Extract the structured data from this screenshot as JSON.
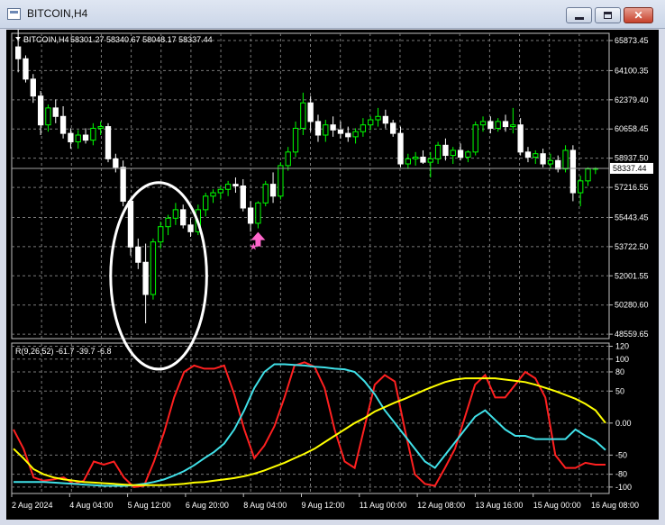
{
  "window": {
    "title": "BITCOIN,H4"
  },
  "chart_data": [
    {
      "type": "candlestick",
      "title": "BITCOIN,H4",
      "ohlc_label": "58301.27 58340.67 58048.17 58337.44",
      "y_ticks": [
        "65873.45",
        "64100.35",
        "62379.40",
        "60658.45",
        "58937.50",
        "57216.55",
        "55443.45",
        "53722.50",
        "52001.55",
        "50280.60",
        "48559.65"
      ],
      "ylim": [
        48300,
        66300
      ],
      "current_price": 58337.44,
      "current_price_label": "58337.44",
      "x_ticks": [
        "2 Aug 2024",
        "4 Aug 04:00",
        "5 Aug 12:00",
        "6 Aug 20:00",
        "8 Aug 04:00",
        "9 Aug 12:00",
        "11 Aug 00:00",
        "12 Aug 08:00",
        "13 Aug 16:00",
        "15 Aug 00:00",
        "16 Aug 08:00"
      ],
      "colors": {
        "up": "#00ff00",
        "down": "#ffffff",
        "background": "#000000",
        "grid": "#7a7a7a"
      },
      "candles": [
        [
          65500,
          66600,
          64000,
          64800
        ],
        [
          64800,
          65000,
          63400,
          63600
        ],
        [
          63600,
          63900,
          62200,
          62600
        ],
        [
          62600,
          62900,
          60300,
          60900
        ],
        [
          60900,
          62100,
          60500,
          61900
        ],
        [
          61900,
          62400,
          61000,
          61400
        ],
        [
          61400,
          62000,
          60100,
          60400
        ],
        [
          60400,
          60700,
          59500,
          59900
        ],
        [
          59900,
          60600,
          59500,
          60300
        ],
        [
          60300,
          60700,
          59800,
          60000
        ],
        [
          60000,
          61000,
          59700,
          60700
        ],
        [
          60700,
          61100,
          60300,
          60800
        ],
        [
          60800,
          61000,
          58700,
          58900
        ],
        [
          58900,
          59200,
          58100,
          58400
        ],
        [
          58400,
          58800,
          56100,
          56400
        ],
        [
          56400,
          56600,
          53200,
          53700
        ],
        [
          53700,
          54200,
          52400,
          52800
        ],
        [
          52800,
          53900,
          49200,
          50900
        ],
        [
          50900,
          54200,
          50600,
          54000
        ],
        [
          54000,
          55200,
          53600,
          54900
        ],
        [
          54900,
          55600,
          54400,
          55400
        ],
        [
          55400,
          56300,
          55000,
          55900
        ],
        [
          55900,
          56200,
          54800,
          55000
        ],
        [
          55000,
          55400,
          54300,
          54600
        ],
        [
          54600,
          56200,
          54400,
          55900
        ],
        [
          55900,
          56900,
          55500,
          56700
        ],
        [
          56700,
          57100,
          56300,
          56900
        ],
        [
          56900,
          57300,
          56500,
          57100
        ],
        [
          57100,
          57600,
          56700,
          57400
        ],
        [
          57400,
          57800,
          56900,
          57300
        ],
        [
          57300,
          57700,
          55800,
          56000
        ],
        [
          56000,
          56400,
          54600,
          55100
        ],
        [
          55100,
          56400,
          54800,
          56300
        ],
        [
          56300,
          57600,
          56100,
          57400
        ],
        [
          57400,
          58100,
          56300,
          56700
        ],
        [
          56700,
          58700,
          56500,
          58500
        ],
        [
          58500,
          59600,
          58200,
          59300
        ],
        [
          59300,
          61100,
          59000,
          60700
        ],
        [
          60700,
          62800,
          60300,
          62200
        ],
        [
          62200,
          62600,
          60500,
          61100
        ],
        [
          61100,
          61500,
          59900,
          60300
        ],
        [
          60300,
          61200,
          59900,
          60900
        ],
        [
          60900,
          61400,
          60200,
          60600
        ],
        [
          60600,
          61100,
          60100,
          60400
        ],
        [
          60400,
          60800,
          59900,
          60200
        ],
        [
          60200,
          60700,
          59800,
          60500
        ],
        [
          60500,
          61300,
          60200,
          60900
        ],
        [
          60900,
          61400,
          60600,
          61200
        ],
        [
          61200,
          61900,
          60800,
          61400
        ],
        [
          61400,
          61800,
          60700,
          61000
        ],
        [
          61000,
          61200,
          60200,
          60400
        ],
        [
          60400,
          60800,
          58400,
          58600
        ],
        [
          58600,
          59200,
          58300,
          58900
        ],
        [
          58900,
          59300,
          58500,
          59000
        ],
        [
          59000,
          59400,
          58600,
          58700
        ],
        [
          58700,
          59300,
          57800,
          58900
        ],
        [
          58900,
          59900,
          58600,
          59700
        ],
        [
          59700,
          60100,
          58800,
          59100
        ],
        [
          59100,
          59600,
          58600,
          59400
        ],
        [
          59400,
          59800,
          58800,
          59000
        ],
        [
          59000,
          59400,
          58700,
          59300
        ],
        [
          59300,
          61100,
          59100,
          60900
        ],
        [
          60900,
          61400,
          60500,
          61100
        ],
        [
          61100,
          61400,
          60400,
          60700
        ],
        [
          60700,
          61300,
          60500,
          61100
        ],
        [
          61100,
          61500,
          60500,
          60800
        ],
        [
          60800,
          61900,
          60400,
          60900
        ],
        [
          60900,
          61300,
          59100,
          59300
        ],
        [
          59300,
          59600,
          58700,
          59000
        ],
        [
          59000,
          59400,
          58600,
          59200
        ],
        [
          59200,
          59500,
          58400,
          58600
        ],
        [
          58600,
          59200,
          58300,
          58800
        ],
        [
          58800,
          59100,
          58100,
          58300
        ],
        [
          58300,
          59700,
          58100,
          59400
        ],
        [
          59400,
          59700,
          56400,
          56900
        ],
        [
          56900,
          57900,
          56100,
          57600
        ],
        [
          57600,
          58400,
          57300,
          58300
        ],
        [
          58300,
          58400,
          58000,
          58337
        ]
      ],
      "marker": {
        "label": "buy-arrow",
        "color": "#ff66cc",
        "candle_index": 32
      }
    },
    {
      "type": "line",
      "title": "R(9,26,52) -61.7 -39.7 -6.8",
      "y_ticks": [
        "120",
        "100",
        "80",
        "50",
        "0.00",
        "-50",
        "-80",
        "-100"
      ],
      "ylim": [
        -110,
        125
      ],
      "series": [
        {
          "color": "#ff2020",
          "values": [
            -10,
            -40,
            -85,
            -90,
            -88,
            -85,
            -95,
            -90,
            -60,
            -65,
            -60,
            -85,
            -100,
            -98,
            -60,
            -15,
            40,
            80,
            90,
            85,
            85,
            90,
            45,
            -10,
            -55,
            -35,
            -5,
            40,
            90,
            95,
            88,
            55,
            -10,
            -60,
            -70,
            -5,
            60,
            75,
            65,
            -10,
            -80,
            -95,
            -98,
            -70,
            -40,
            10,
            60,
            75,
            40,
            40,
            60,
            80,
            70,
            40,
            -50,
            -70,
            -70,
            -62,
            -65,
            -65
          ]
        },
        {
          "color": "#40e0e8",
          "values": [
            -92,
            -92,
            -92,
            -92,
            -93,
            -94,
            -95,
            -96,
            -97,
            -98,
            -98,
            -98,
            -97,
            -95,
            -92,
            -88,
            -82,
            -75,
            -66,
            -55,
            -45,
            -32,
            -10,
            20,
            55,
            80,
            92,
            92,
            91,
            90,
            88,
            87,
            85,
            84,
            80,
            65,
            45,
            20,
            0,
            -20,
            -40,
            -60,
            -70,
            -50,
            -30,
            -10,
            10,
            20,
            5,
            -10,
            -20,
            -20,
            -25,
            -25,
            -25,
            -25,
            -10,
            -20,
            -28,
            -42
          ]
        },
        {
          "color": "#ffff00",
          "values": [
            -40,
            -55,
            -72,
            -80,
            -85,
            -88,
            -90,
            -92,
            -93,
            -94,
            -95,
            -96,
            -97,
            -97,
            -97,
            -97,
            -96,
            -95,
            -93,
            -92,
            -90,
            -88,
            -86,
            -83,
            -79,
            -74,
            -68,
            -62,
            -55,
            -48,
            -40,
            -30,
            -20,
            -10,
            0,
            8,
            18,
            25,
            32,
            38,
            45,
            52,
            58,
            64,
            68,
            70,
            70,
            70,
            70,
            68,
            66,
            64,
            60,
            55,
            50,
            44,
            38,
            30,
            20,
            0
          ]
        }
      ]
    }
  ]
}
